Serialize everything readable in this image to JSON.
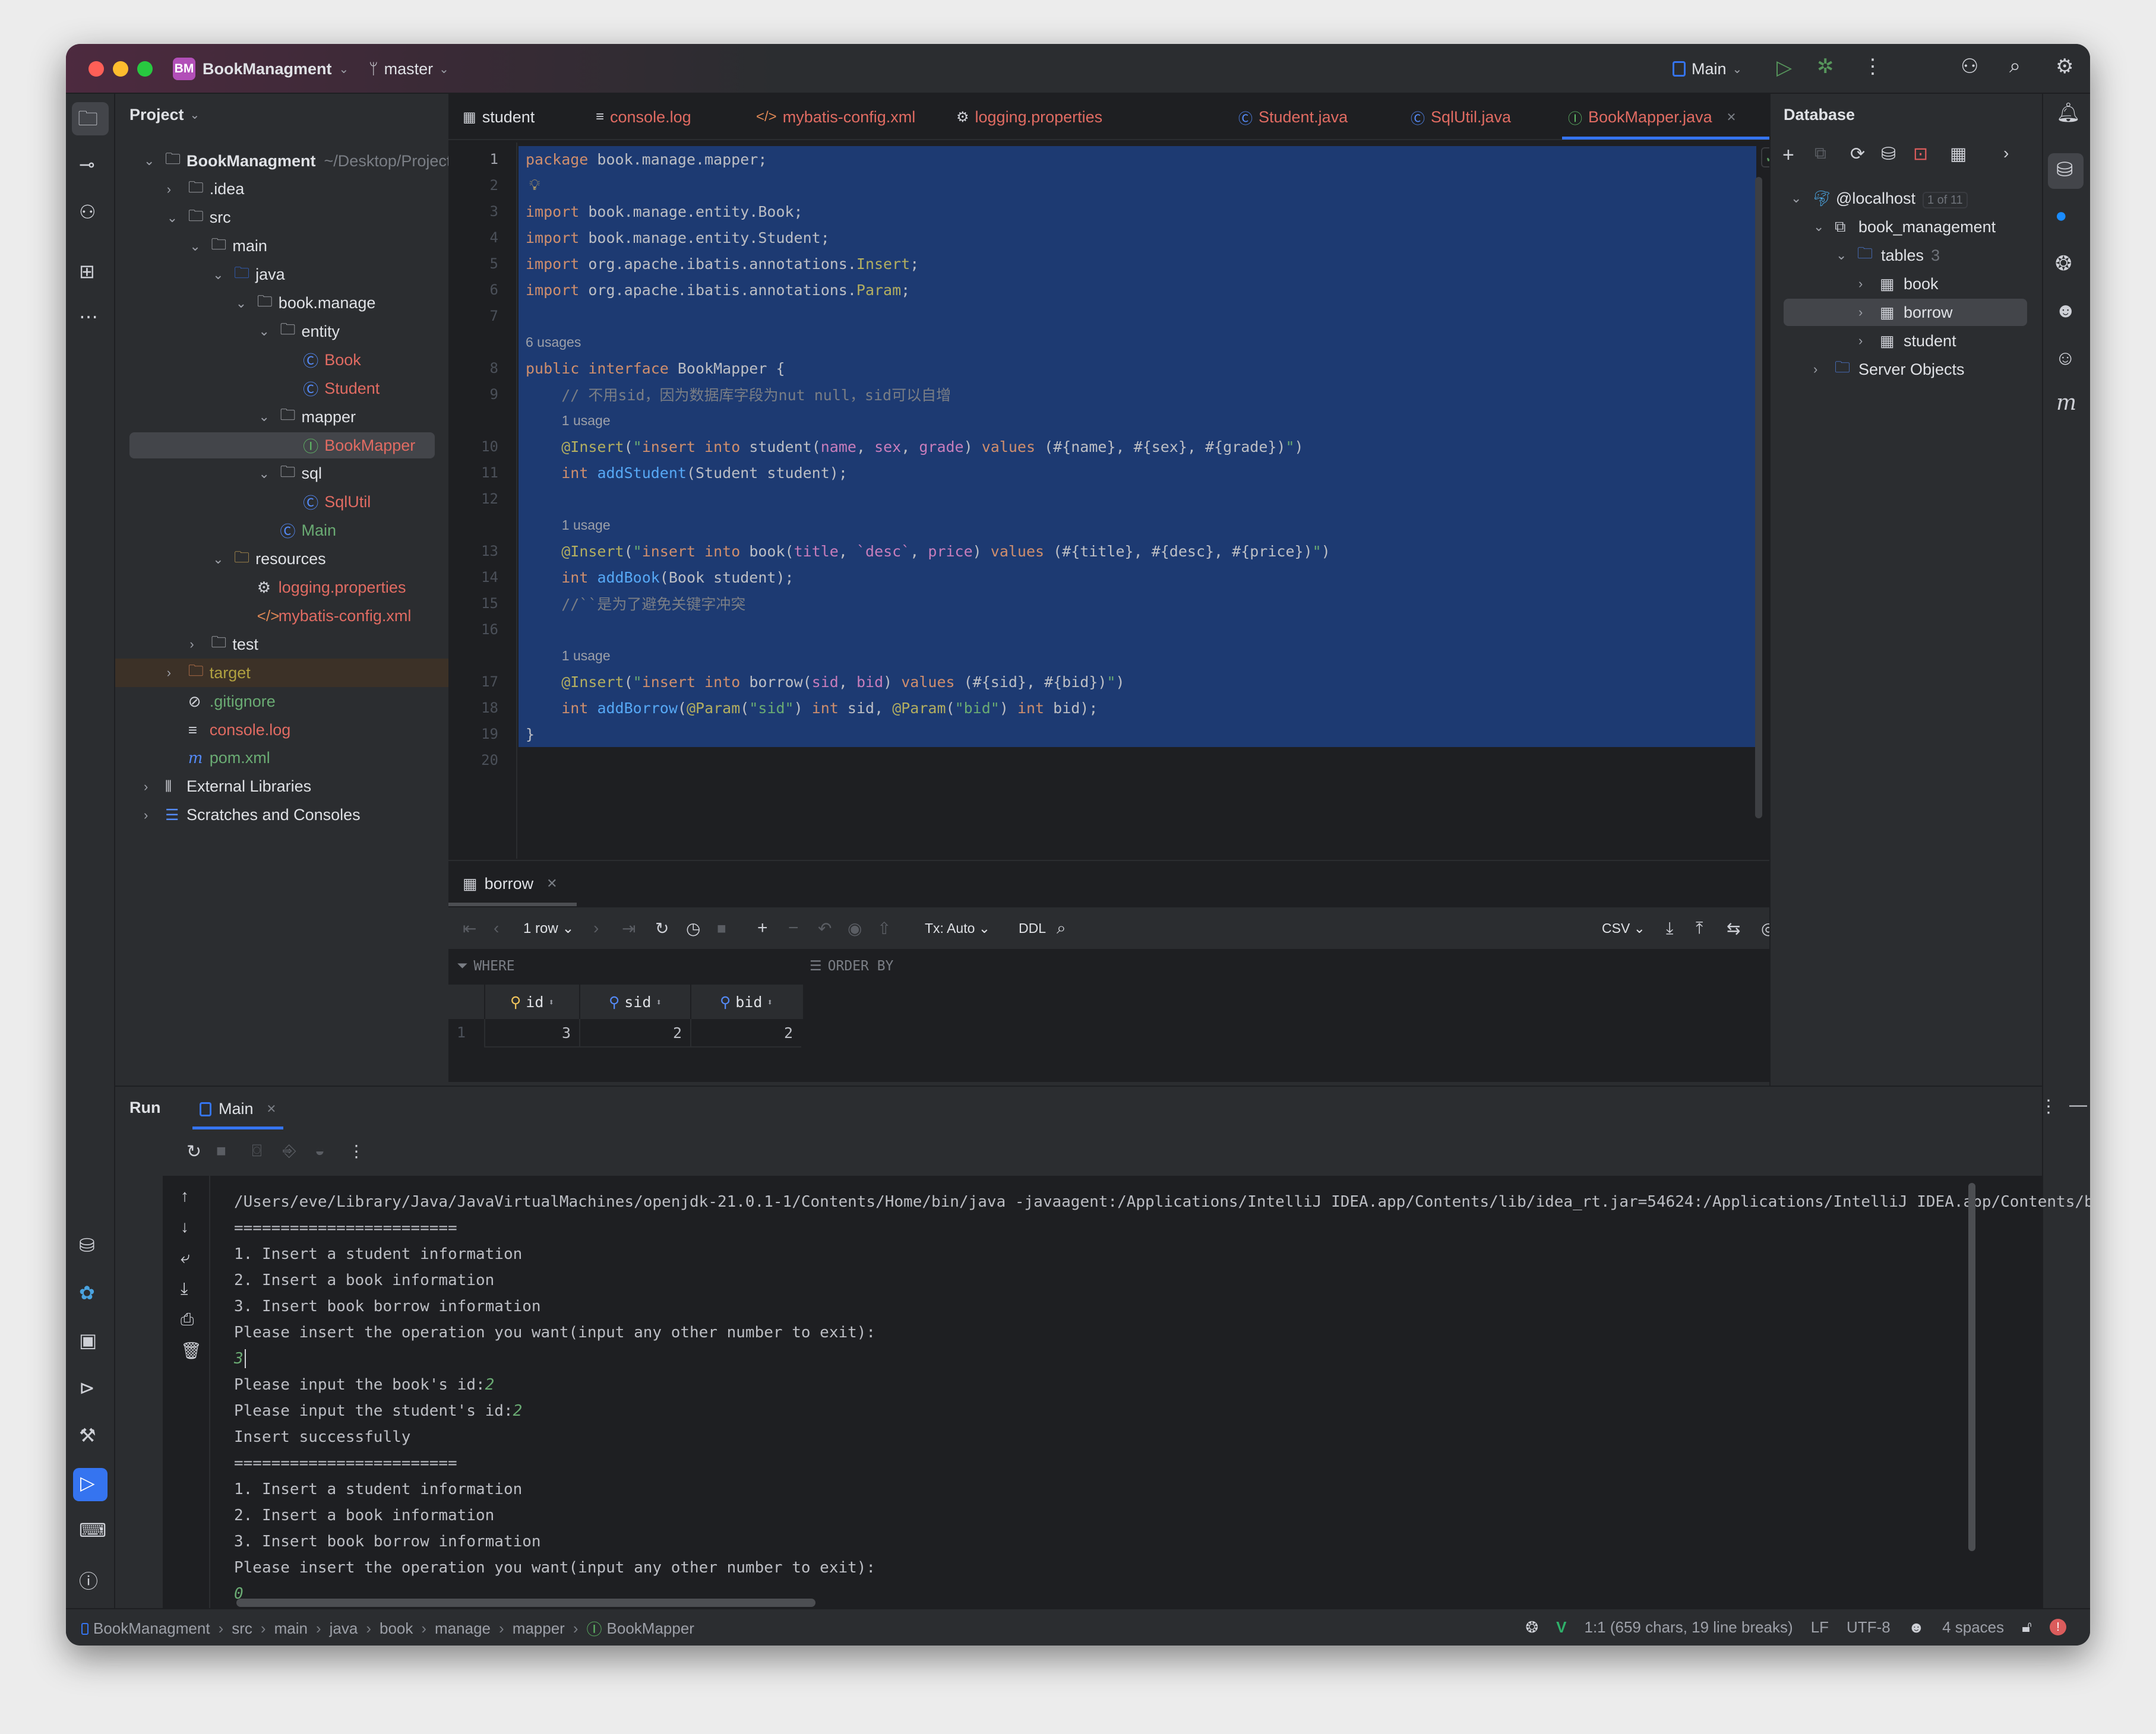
{
  "window": {
    "project_badge": "BM",
    "project_name": "BookManagment",
    "branch": "master",
    "run_config": "Main",
    "badge_color": "#b24fb8"
  },
  "left_strip": {
    "top_icons": [
      "folder-icon",
      "commit-icon",
      "git-people-icon",
      "structure-icon",
      "more-icon"
    ],
    "bottom_icons": [
      "database-icon",
      "python-icon",
      "services-icon",
      "play-circle-icon",
      "build-icon",
      "run-icon",
      "terminal-icon",
      "problems-icon",
      "git-icon"
    ]
  },
  "project_panel": {
    "title": "Project",
    "items": [
      {
        "depth": 0,
        "arrow": "down",
        "icon": "project-folder",
        "label": "BookManagment",
        "bold": true,
        "extra": "~/Desktop/Projects",
        "color": "#dfe1e5"
      },
      {
        "depth": 1,
        "arrow": "right",
        "icon": "folder",
        "label": ".idea",
        "color": "#dfe1e5"
      },
      {
        "depth": 1,
        "arrow": "down",
        "icon": "folder",
        "label": "src",
        "color": "#dfe1e5"
      },
      {
        "depth": 2,
        "arrow": "down",
        "icon": "folder",
        "label": "main",
        "color": "#dfe1e5"
      },
      {
        "depth": 3,
        "arrow": "down",
        "icon": "source-folder",
        "label": "java",
        "color": "#dfe1e5"
      },
      {
        "depth": 4,
        "arrow": "down",
        "icon": "package",
        "label": "book.manage",
        "color": "#dfe1e5"
      },
      {
        "depth": 5,
        "arrow": "down",
        "icon": "package",
        "label": "entity",
        "color": "#dfe1e5"
      },
      {
        "depth": 6,
        "arrow": null,
        "icon": "class",
        "label": "Book",
        "color": "#e06b62"
      },
      {
        "depth": 6,
        "arrow": null,
        "icon": "class",
        "label": "Student",
        "color": "#e06b62"
      },
      {
        "depth": 5,
        "arrow": "down",
        "icon": "package",
        "label": "mapper",
        "color": "#dfe1e5"
      },
      {
        "depth": 6,
        "arrow": null,
        "icon": "interface",
        "label": "BookMapper",
        "color": "#e06b62",
        "selected": true
      },
      {
        "depth": 5,
        "arrow": "down",
        "icon": "package",
        "label": "sql",
        "color": "#dfe1e5"
      },
      {
        "depth": 6,
        "arrow": null,
        "icon": "class",
        "label": "SqlUtil",
        "color": "#e06b62"
      },
      {
        "depth": 5,
        "arrow": null,
        "icon": "class",
        "label": "Main",
        "color": "#6aab73"
      },
      {
        "depth": 3,
        "arrow": "down",
        "icon": "resources-folder",
        "label": "resources",
        "color": "#dfe1e5"
      },
      {
        "depth": 4,
        "arrow": null,
        "icon": "gear",
        "label": "logging.properties",
        "color": "#e06b62"
      },
      {
        "depth": 4,
        "arrow": null,
        "icon": "xml",
        "label": "mybatis-config.xml",
        "color": "#e06b62"
      },
      {
        "depth": 2,
        "arrow": "right",
        "icon": "folder",
        "label": "test",
        "color": "#dfe1e5"
      },
      {
        "depth": 1,
        "arrow": "right",
        "icon": "excluded-folder",
        "label": "target",
        "color": "#b0a040",
        "highlight": true
      },
      {
        "depth": 1,
        "arrow": null,
        "icon": "ignore",
        "label": ".gitignore",
        "color": "#6aab73"
      },
      {
        "depth": 1,
        "arrow": null,
        "icon": "text",
        "label": "console.log",
        "color": "#e06b62"
      },
      {
        "depth": 1,
        "arrow": null,
        "icon": "maven",
        "label": "pom.xml",
        "color": "#6aab73"
      },
      {
        "depth": 0,
        "arrow": "right",
        "icon": "libraries",
        "label": "External Libraries",
        "color": "#dfe1e5"
      },
      {
        "depth": 0,
        "arrow": "right",
        "icon": "scratches",
        "label": "Scratches and Consoles",
        "color": "#dfe1e5"
      }
    ]
  },
  "editor_tabs": [
    {
      "icon": "table-icon",
      "label": "student",
      "color": "#dfe1e5"
    },
    {
      "icon": "text-icon",
      "label": "console.log",
      "color": "#e06b62"
    },
    {
      "icon": "xml-icon",
      "label": "mybatis-config.xml",
      "color": "#e06b62"
    },
    {
      "icon": "gear-icon",
      "label": "logging.properties",
      "color": "#e06b62"
    },
    {
      "icon": "class-icon",
      "label": "Student.java",
      "color": "#e06b62"
    },
    {
      "icon": "class-icon",
      "label": "SqlUtil.java",
      "color": "#e06b62"
    },
    {
      "icon": "interface-icon",
      "label": "BookMapper.java",
      "color": "#e06b62",
      "active": true
    }
  ],
  "editor": {
    "syntax_colors": {
      "kw": "#cf8e6d",
      "ann": "#b3ae60",
      "str": "#6aab73",
      "fn": "#56a8f5",
      "col": "#c77dbb",
      "cmt": "#7a7e85",
      "plain": "#bcbec4"
    },
    "selection_color": "#1d3a72",
    "rows": [
      {
        "num": "1",
        "sel": true,
        "segs": [
          [
            "kw",
            "package"
          ],
          [
            "plain",
            " book.manage.mapper;"
          ]
        ]
      },
      {
        "num": "2",
        "sel": true,
        "bulb": true,
        "segs": []
      },
      {
        "num": "3",
        "sel": true,
        "segs": [
          [
            "kw",
            "import"
          ],
          [
            "plain",
            " book.manage.entity.Book;"
          ]
        ]
      },
      {
        "num": "4",
        "sel": true,
        "segs": [
          [
            "kw",
            "import"
          ],
          [
            "plain",
            " book.manage.entity.Student;"
          ]
        ]
      },
      {
        "num": "5",
        "sel": true,
        "segs": [
          [
            "kw",
            "import"
          ],
          [
            "plain",
            " org.apache.ibatis.annotations."
          ],
          [
            "ann",
            "Insert"
          ],
          [
            "plain",
            ";"
          ]
        ]
      },
      {
        "num": "6",
        "sel": true,
        "segs": [
          [
            "kw",
            "import"
          ],
          [
            "plain",
            " org.apache.ibatis.annotations."
          ],
          [
            "ann",
            "Param"
          ],
          [
            "plain",
            ";"
          ]
        ]
      },
      {
        "num": "7",
        "sel": true,
        "segs": []
      },
      {
        "inlay": "6 usages",
        "indent": 0,
        "sel": true
      },
      {
        "num": "8",
        "sel": true,
        "segs": [
          [
            "kw",
            "public interface"
          ],
          [
            "plain",
            " BookMapper {"
          ]
        ]
      },
      {
        "num": "9",
        "sel": true,
        "segs": [
          [
            "plain",
            "    "
          ],
          [
            "cmt",
            "// 不用sid，因为数据库字段为nut null，sid可以自增"
          ]
        ]
      },
      {
        "inlay": "1 usage",
        "indent": 4,
        "sel": true
      },
      {
        "num": "10",
        "sel": true,
        "segs": [
          [
            "plain",
            "    "
          ],
          [
            "ann",
            "@Insert"
          ],
          [
            "plain",
            "("
          ],
          [
            "str",
            "\""
          ],
          [
            "kw",
            "insert into"
          ],
          [
            "plain",
            " student("
          ],
          [
            "col",
            "name"
          ],
          [
            "plain",
            ", "
          ],
          [
            "col",
            "sex"
          ],
          [
            "plain",
            ", "
          ],
          [
            "col",
            "grade"
          ],
          [
            "plain",
            ") "
          ],
          [
            "kw",
            "values"
          ],
          [
            "plain",
            " (#{name}, #{sex}, #{grade})"
          ],
          [
            "str",
            "\""
          ],
          [
            "plain",
            ")"
          ]
        ]
      },
      {
        "num": "11",
        "sel": true,
        "segs": [
          [
            "plain",
            "    "
          ],
          [
            "kw",
            "int"
          ],
          [
            "plain",
            " "
          ],
          [
            "fn",
            "addStudent"
          ],
          [
            "plain",
            "(Student student);"
          ]
        ]
      },
      {
        "num": "12",
        "sel": true,
        "segs": []
      },
      {
        "inlay": "1 usage",
        "indent": 4,
        "sel": true
      },
      {
        "num": "13",
        "sel": true,
        "segs": [
          [
            "plain",
            "    "
          ],
          [
            "ann",
            "@Insert"
          ],
          [
            "plain",
            "("
          ],
          [
            "str",
            "\""
          ],
          [
            "kw",
            "insert into"
          ],
          [
            "plain",
            " book("
          ],
          [
            "col",
            "title"
          ],
          [
            "plain",
            ", "
          ],
          [
            "col",
            "`desc`"
          ],
          [
            "plain",
            ", "
          ],
          [
            "col",
            "price"
          ],
          [
            "plain",
            ") "
          ],
          [
            "kw",
            "values"
          ],
          [
            "plain",
            " (#{title}, #{desc}, #{price})"
          ],
          [
            "str",
            "\""
          ],
          [
            "plain",
            ")"
          ]
        ]
      },
      {
        "num": "14",
        "sel": true,
        "segs": [
          [
            "plain",
            "    "
          ],
          [
            "kw",
            "int"
          ],
          [
            "plain",
            " "
          ],
          [
            "fn",
            "addBook"
          ],
          [
            "plain",
            "(Book student);"
          ]
        ]
      },
      {
        "num": "15",
        "sel": true,
        "segs": [
          [
            "plain",
            "    "
          ],
          [
            "cmt",
            "//``是为了避免关键字冲突"
          ]
        ]
      },
      {
        "num": "16",
        "sel": true,
        "segs": []
      },
      {
        "inlay": "1 usage",
        "indent": 4,
        "sel": true
      },
      {
        "num": "17",
        "sel": true,
        "segs": [
          [
            "plain",
            "    "
          ],
          [
            "ann",
            "@Insert"
          ],
          [
            "plain",
            "("
          ],
          [
            "str",
            "\""
          ],
          [
            "kw",
            "insert into"
          ],
          [
            "plain",
            " borrow("
          ],
          [
            "col",
            "sid"
          ],
          [
            "plain",
            ", "
          ],
          [
            "col",
            "bid"
          ],
          [
            "plain",
            ") "
          ],
          [
            "kw",
            "values"
          ],
          [
            "plain",
            " (#{sid}, #{bid})"
          ],
          [
            "str",
            "\""
          ],
          [
            "plain",
            ")"
          ]
        ]
      },
      {
        "num": "18",
        "sel": true,
        "segs": [
          [
            "plain",
            "    "
          ],
          [
            "kw",
            "int"
          ],
          [
            "plain",
            " "
          ],
          [
            "fn",
            "addBorrow"
          ],
          [
            "plain",
            "("
          ],
          [
            "ann",
            "@Param"
          ],
          [
            "plain",
            "("
          ],
          [
            "str",
            "\"sid\""
          ],
          [
            "plain",
            ") "
          ],
          [
            "kw",
            "int"
          ],
          [
            "plain",
            " sid, "
          ],
          [
            "ann",
            "@Param"
          ],
          [
            "plain",
            "("
          ],
          [
            "str",
            "\"bid\""
          ],
          [
            "plain",
            ") "
          ],
          [
            "kw",
            "int"
          ],
          [
            "plain",
            " bid);"
          ]
        ]
      },
      {
        "num": "19",
        "sel": true,
        "segs": [
          [
            "plain",
            "}"
          ]
        ]
      },
      {
        "num": "20",
        "sel": false,
        "segs": []
      }
    ]
  },
  "database_panel": {
    "title": "Database",
    "items": [
      {
        "depth": 0,
        "arrow": "down",
        "icon": "mysql",
        "label": "@localhost",
        "badge": "1 of 11"
      },
      {
        "depth": 1,
        "arrow": "down",
        "icon": "schema",
        "label": "book_management"
      },
      {
        "depth": 2,
        "arrow": "down",
        "icon": "folder-blue",
        "label": "tables",
        "count": "3"
      },
      {
        "depth": 3,
        "arrow": "right",
        "icon": "table",
        "label": "book"
      },
      {
        "depth": 3,
        "arrow": "right",
        "icon": "table",
        "label": "borrow",
        "selected": true
      },
      {
        "depth": 3,
        "arrow": "right",
        "icon": "table",
        "label": "student"
      },
      {
        "depth": 1,
        "arrow": "right",
        "icon": "server-objects",
        "label": "Server Objects"
      }
    ]
  },
  "results": {
    "tab_label": "borrow",
    "rows_selector": "1 row",
    "tx_mode": "Tx: Auto",
    "ddl_label": "DDL",
    "export_format": "CSV",
    "where_label": "WHERE",
    "order_by_label": "ORDER BY",
    "columns": [
      "id",
      "sid",
      "bid"
    ],
    "rows": [
      {
        "n": "1",
        "values": [
          "3",
          "2",
          "2"
        ]
      }
    ]
  },
  "run_panel": {
    "title": "Run",
    "tab_label": "Main",
    "console": [
      {
        "text": "/Users/eve/Library/Java/JavaVirtualMachines/openjdk-21.0.1-1/Contents/Home/bin/java -javaagent:/Applications/IntelliJ IDEA.app/Contents/lib/idea_rt.jar=54624:/Applications/IntelliJ IDEA.app/Contents/b:"
      },
      {
        "text": "========================"
      },
      {
        "text": "1. Insert a student information"
      },
      {
        "text": "2. Insert a book information"
      },
      {
        "text": "3. Insert book borrow information"
      },
      {
        "text": "Please insert the operation you want(input any other number to exit):"
      },
      {
        "text": "",
        "input": "3",
        "cursor": true
      },
      {
        "text": "Please input the book's id:",
        "input": "2"
      },
      {
        "text": "Please input the student's id:",
        "input": "2"
      },
      {
        "text": "Insert successfully"
      },
      {
        "text": "========================"
      },
      {
        "text": "1. Insert a student information"
      },
      {
        "text": "2. Insert a book information"
      },
      {
        "text": "3. Insert book borrow information"
      },
      {
        "text": "Please insert the operation you want(input any other number to exit):"
      },
      {
        "text": "",
        "input": "0"
      }
    ]
  },
  "status_bar": {
    "breadcrumbs": [
      "BookManagment",
      "src",
      "main",
      "java",
      "book",
      "manage",
      "mapper",
      "BookMapper"
    ],
    "position": "1:1 (659 chars, 19 line breaks)",
    "line_ending": "LF",
    "encoding": "UTF-8",
    "indent": "4 spaces"
  }
}
